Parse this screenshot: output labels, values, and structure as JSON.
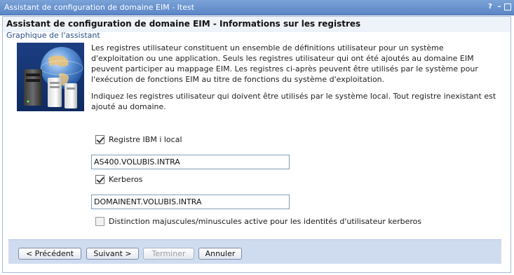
{
  "window": {
    "title": "Assistant de configuration de domaine EIM - Itest",
    "controls": [
      "?",
      "–",
      "□"
    ]
  },
  "header": {
    "title": "Assistant de configuration de domaine EIM - Informations sur les registres",
    "graphic_link": "Graphique de l'assistant"
  },
  "content": {
    "paragraph1": "Les registres utilisateur constituent un ensemble de définitions utilisateur pour un système d'exploitation ou une application. Seuls les registres utilisateur qui ont été ajoutés au domaine EIM peuvent participer au mappage EIM. Les registres ci-après peuvent être utilisés par le système pour l'exécution de fonctions EIM au titre de fonctions du système d'exploitation.",
    "paragraph2": "Indiquez les registres utilisateur qui doivent être utilisés par le système local. Tout registre inexistant est ajouté au domaine.",
    "local_registry": {
      "label": "Registre IBM i local",
      "checked": true,
      "value": "AS400.VOLUBIS.INTRA"
    },
    "kerberos": {
      "label": "Kerberos",
      "checked": true,
      "value": "DOMAINENT.VOLUBIS.INTRA"
    },
    "case_sensitive": {
      "label": "Distinction majuscules/minuscules active pour les identités d'utilisateur kerberos",
      "checked": false
    }
  },
  "footer": {
    "back_label": "< Précédent",
    "next_label": "Suivant >",
    "finish_label": "Terminer",
    "cancel_label": "Annuler"
  },
  "icons": {
    "illustration": "server-globe-illustration"
  }
}
